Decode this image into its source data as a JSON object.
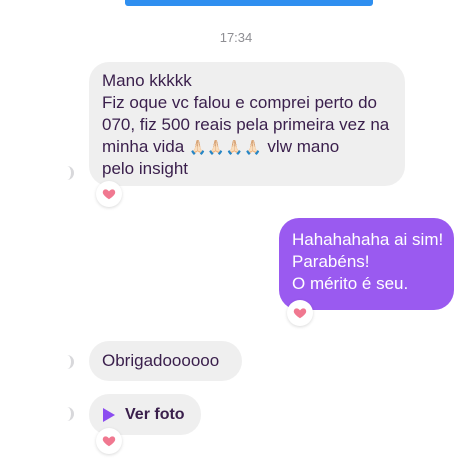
{
  "timestamp": "17:34",
  "messages": [
    {
      "direction": "incoming",
      "lines": [
        "Mano kkkkk",
        "Fiz oque vc falou e comprei perto do",
        "070, fiz 500 reais pela primeira vez na",
        "minha vida",
        "vlw mano",
        "pelo insight"
      ],
      "emoji": "🙏🏻🙏🏻🙏🏻🙏🏻",
      "reaction": "heart"
    },
    {
      "direction": "outgoing",
      "lines": [
        "Hahahahaha ai sim!",
        "Parabéns!",
        "O mérito é seu."
      ],
      "reaction": "heart"
    },
    {
      "direction": "incoming",
      "text": "Obrigadoooooo"
    },
    {
      "direction": "incoming",
      "type": "media",
      "label": "Ver foto",
      "icon": "play-icon",
      "reaction": "heart"
    }
  ],
  "colors": {
    "outgoing_bubble": "#9a5af0",
    "incoming_bubble": "#efefef",
    "reaction_heart": "#f07890",
    "accent_bar": "#2f8ff0"
  }
}
